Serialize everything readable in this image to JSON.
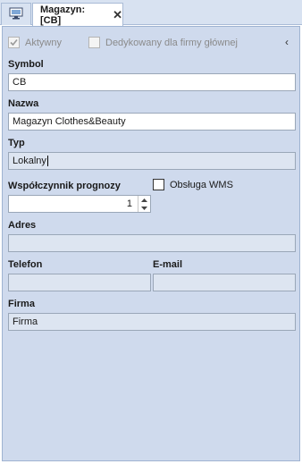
{
  "tabs": {
    "active_label": "Magazyn:[CB]"
  },
  "options": {
    "aktywny": "Aktywny",
    "dedykowany": "Dedykowany dla firmy głównej",
    "obsluga_wms": "Obsługa WMS"
  },
  "form": {
    "symbol_label": "Symbol",
    "symbol_value": "CB",
    "nazwa_label": "Nazwa",
    "nazwa_value": "Magazyn Clothes&Beauty",
    "typ_label": "Typ",
    "typ_value": "Lokalny",
    "wspolczynnik_label": "Współczynnik prognozy",
    "wspolczynnik_value": "1",
    "adres_label": "Adres",
    "adres_value": "",
    "telefon_label": "Telefon",
    "telefon_value": "",
    "email_label": "E-mail",
    "email_value": "",
    "firma_label": "Firma",
    "firma_value": "Firma"
  },
  "colors": {
    "panel_bg": "#cfdaed",
    "tabstrip_bg": "#d8e2f1",
    "border": "#9aa7b8"
  },
  "icons": [
    "monitor-icon",
    "close-icon",
    "collapse-icon",
    "checkmark-icon",
    "spin-up-icon",
    "spin-down-icon"
  ]
}
